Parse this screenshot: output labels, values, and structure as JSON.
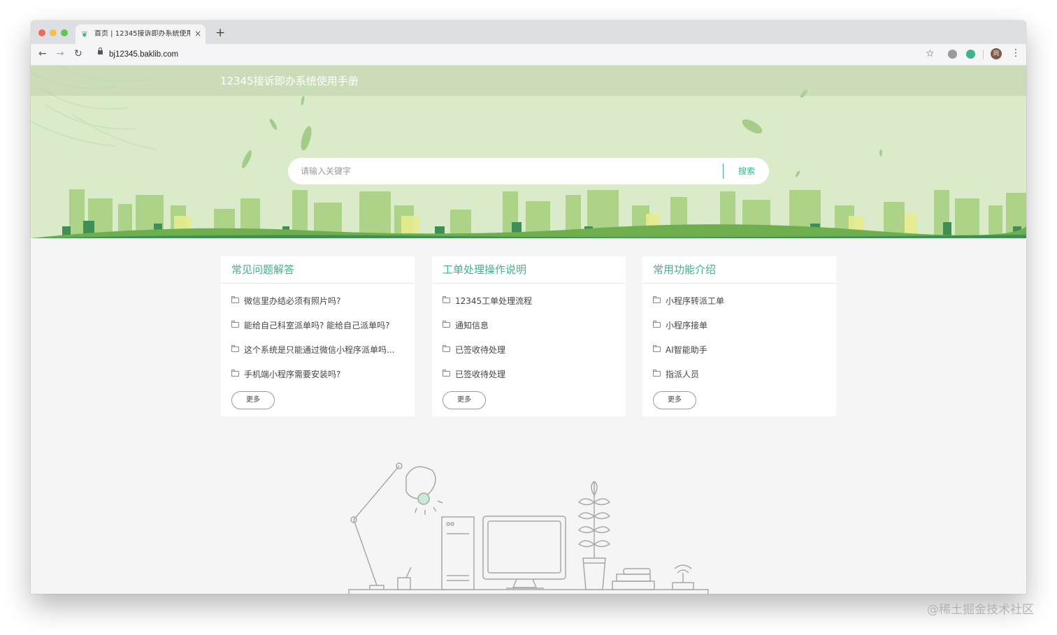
{
  "browser": {
    "tab_title": "首页 | 12345接诉即办系统使用手",
    "tab_close": "×",
    "new_tab": "+",
    "url": "bj12345.baklib.com",
    "avatar_text": "同",
    "nav": {
      "back": "←",
      "forward": "→",
      "reload": "↻",
      "star": "☆",
      "menu": "⋮"
    }
  },
  "hero": {
    "site_title": "12345接诉即办系统使用手册",
    "search_placeholder": "请输入关键字",
    "search_button": "搜索",
    "colors": {
      "background": "#d9ebc9",
      "skyline": "#8fc269",
      "accent": "#3fb28c"
    }
  },
  "cards": [
    {
      "title": "常见问题解答",
      "items": [
        "微信里办结必须有照片吗?",
        "能给自己科室派单吗? 能给自己派单吗?",
        "这个系统是只能通过微信小程序派单吗...",
        "手机端小程序需要安装吗?"
      ],
      "more": "更多"
    },
    {
      "title": "工单处理操作说明",
      "items": [
        "12345工单处理流程",
        "通知信息",
        "已签收待处理",
        "已签收待处理"
      ],
      "more": "更多"
    },
    {
      "title": "常用功能介绍",
      "items": [
        "小程序转派工单",
        "小程序接单",
        "AI智能助手",
        "指派人员"
      ],
      "more": "更多"
    }
  ],
  "watermark": "@稀土掘金技术社区",
  "icons": [
    "favicon-icon",
    "lock-icon",
    "folder-icon",
    "star-icon",
    "extension-icon",
    "menu-icon"
  ]
}
